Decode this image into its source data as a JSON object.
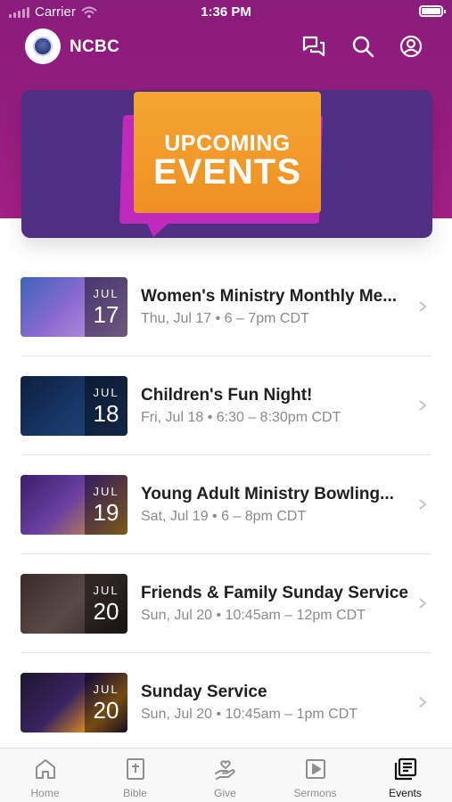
{
  "status_bar": {
    "carrier": "Carrier",
    "time": "1:36 PM"
  },
  "app": {
    "title": "NCBC"
  },
  "header_icons": [
    "chat-icon",
    "search-icon",
    "account-icon"
  ],
  "banner": {
    "line1": "UPCOMING",
    "line2": "EVENTS"
  },
  "colors": {
    "header": "#951d7f",
    "banner_bg": "#4e2f84",
    "bubble_front": "#f4a630",
    "bubble_back": "#c02abb"
  },
  "events": [
    {
      "title": "Women's Ministry Monthly Me...",
      "subtitle": "Thu, Jul 17 • 6 – 7pm CDT",
      "month": "JUL",
      "day": "17"
    },
    {
      "title": "Children's Fun Night!",
      "subtitle": "Fri, Jul 18 • 6:30 – 8:30pm CDT",
      "month": "JUL",
      "day": "18"
    },
    {
      "title": "Young Adult Ministry Bowling...",
      "subtitle": "Sat, Jul 19 • 6 – 8pm CDT",
      "month": "JUL",
      "day": "19"
    },
    {
      "title": "Friends & Family Sunday Service",
      "subtitle": "Sun, Jul 20 • 10:45am – 12pm CDT",
      "month": "JUL",
      "day": "20"
    },
    {
      "title": "Sunday Service",
      "subtitle": "Sun, Jul 20 • 10:45am – 1pm CDT",
      "month": "JUL",
      "day": "20"
    }
  ],
  "tabs": [
    {
      "label": "Home",
      "icon": "home-icon"
    },
    {
      "label": "Bible",
      "icon": "bible-icon"
    },
    {
      "label": "Give",
      "icon": "give-icon"
    },
    {
      "label": "Sermons",
      "icon": "sermons-icon"
    },
    {
      "label": "Events",
      "icon": "events-icon",
      "active": true
    }
  ]
}
